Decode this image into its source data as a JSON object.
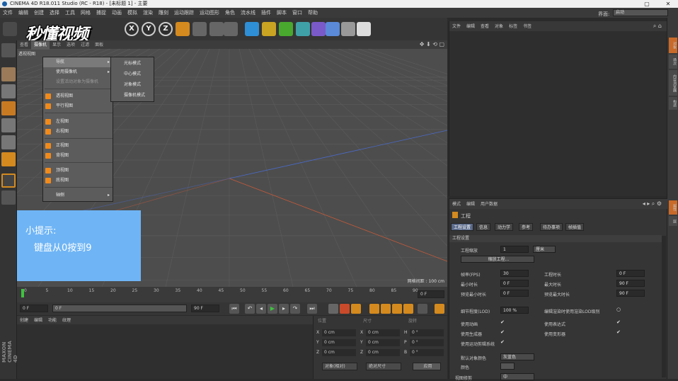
{
  "window": {
    "title": "CINEMA 4D R18.011 Studio (RC - R18) - [未标题 1] - 主要"
  },
  "menubar": {
    "items": [
      "文件",
      "编辑",
      "创建",
      "选择",
      "工具",
      "网格",
      "捕捉",
      "动画",
      "模拟",
      "渲染",
      "雕刻",
      "运动跟踪",
      "运动图形",
      "角色",
      "流水线",
      "插件",
      "脚本",
      "窗口",
      "帮助"
    ],
    "layout_label": "界面:",
    "layout_value": "启动"
  },
  "toolbar": {
    "watermark": "秒懂视频",
    "axis_x": "X",
    "axis_y": "Y",
    "axis_z": "Z"
  },
  "viewport": {
    "menus": [
      "查看",
      "摄像机",
      "显示",
      "选项",
      "过滤",
      "面板"
    ],
    "active_menu": "摄像机",
    "label": "透视视图",
    "grid_scale": "网格间距 : 100 cm"
  },
  "camera_menu": {
    "items": [
      {
        "label": "导航",
        "submenu": true,
        "highlight": true
      },
      {
        "label": "使用摄像机",
        "submenu": true
      },
      {
        "label": "设置活动对象为摄像机",
        "disabled": true
      },
      {
        "label": "透视视图"
      },
      {
        "label": "平行视图"
      },
      {
        "label": "左视图"
      },
      {
        "label": "右视图"
      },
      {
        "label": "正视图"
      },
      {
        "label": "背视图"
      },
      {
        "label": "顶视图"
      },
      {
        "label": "底视图"
      },
      {
        "label": "轴侧",
        "submenu": true
      }
    ]
  },
  "nav_submenu": {
    "items": [
      "光标模式",
      "中心模式",
      "对象模式",
      "摄像机模式"
    ]
  },
  "tip": {
    "title": "小提示:",
    "body": "键盘从0按到9"
  },
  "timeline": {
    "ticks": [
      "0",
      "5",
      "10",
      "15",
      "20",
      "25",
      "30",
      "35",
      "40",
      "45",
      "50",
      "55",
      "60",
      "65",
      "70",
      "75",
      "80",
      "85",
      "90"
    ],
    "current": "0 F"
  },
  "playback": {
    "start": "0 F",
    "current": "0 F",
    "end_a": "90 F",
    "end_b": "90 F"
  },
  "material_manager": {
    "menu": [
      "创建",
      "编辑",
      "功能",
      "纹理"
    ]
  },
  "brand": "MAXON CINEMA 4D",
  "coordinates": {
    "header": [
      "位置",
      "尺寸",
      "旋转"
    ],
    "rows": [
      {
        "a": "X",
        "av": "0 cm",
        "b": "X",
        "bv": "0 cm",
        "c": "H",
        "cv": "0 °"
      },
      {
        "a": "Y",
        "av": "0 cm",
        "b": "Y",
        "bv": "0 cm",
        "c": "P",
        "cv": "0 °"
      },
      {
        "a": "Z",
        "av": "0 cm",
        "b": "Z",
        "bv": "0 cm",
        "c": "B",
        "cv": "0 °"
      }
    ],
    "mode_a": "对象(相对)",
    "mode_b": "绝对尺寸",
    "apply": "应用"
  },
  "object_manager": {
    "menu": [
      "文件",
      "编辑",
      "查看",
      "对象",
      "标签",
      "书签"
    ]
  },
  "right_tabs": [
    "对象",
    "场次",
    "内容浏览器",
    "构造",
    "属性",
    "层"
  ],
  "attributes": {
    "menu": [
      "模式",
      "编辑",
      "用户数据"
    ],
    "title": "工程",
    "tabs": [
      "工程设置",
      "信息",
      "动力学",
      "参考",
      "待办事项",
      "帧插值"
    ],
    "section": "工程设置",
    "scale_label": "工程缩放",
    "scale_value": "1",
    "scale_unit": "厘米",
    "scale_button": "缩放工程...",
    "fps_label": "帧率(FPS)",
    "fps_value": "30",
    "proj_time_label": "工程时长",
    "proj_time_value": "0 F",
    "min_time_label": "最小时长",
    "min_time_value": "0 F",
    "max_time_label": "最大时长",
    "max_time_value": "90 F",
    "prev_min_label": "预览最小时长",
    "prev_min_value": "0 F",
    "prev_max_label": "预览最大时长",
    "prev_max_value": "90 F",
    "lod_label": "细节程度(LOD)",
    "lod_value": "100 %",
    "lod_render_label": "编辑渲染时使用渲染LOD级别",
    "anim_label": "使用动画",
    "expr_label": "使用表达式",
    "gen_label": "使用生成器",
    "deform_label": "使用变形器",
    "motion_label": "使用运动剪辑系统",
    "objcolor_label": "默认对象颜色",
    "objcolor_value": "灰蓝色",
    "color_label": "颜色",
    "view_label": "视图修剪",
    "view_value": "中"
  }
}
